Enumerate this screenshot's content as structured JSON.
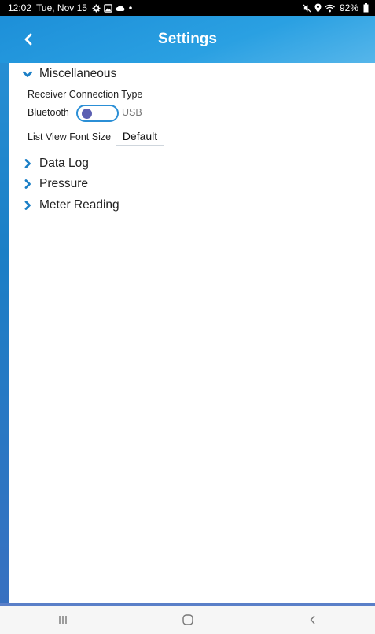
{
  "status_bar": {
    "time": "12:02",
    "date": "Tue, Nov 15",
    "battery": "92%"
  },
  "header": {
    "title": "Settings"
  },
  "sections": {
    "misc": {
      "label": "Miscellaneous",
      "expanded": true
    },
    "data_log": {
      "label": "Data Log",
      "expanded": false
    },
    "pressure": {
      "label": "Pressure",
      "expanded": false
    },
    "meter_reading": {
      "label": "Meter Reading",
      "expanded": false
    }
  },
  "misc": {
    "receiver_label": "Receiver Connection Type",
    "toggle_left": "Bluetooth",
    "toggle_right": "USB",
    "toggle_value": "Bluetooth",
    "font_size_label": "List View Font Size",
    "font_size_value": "Default"
  },
  "colors": {
    "accent": "#2b8fd6",
    "chevron": "#1b7fc6",
    "knob": "#5b5fb2"
  },
  "icons": {
    "back": "chevron-left-icon",
    "expanded": "chevron-down-icon",
    "collapsed": "chevron-right-icon"
  }
}
